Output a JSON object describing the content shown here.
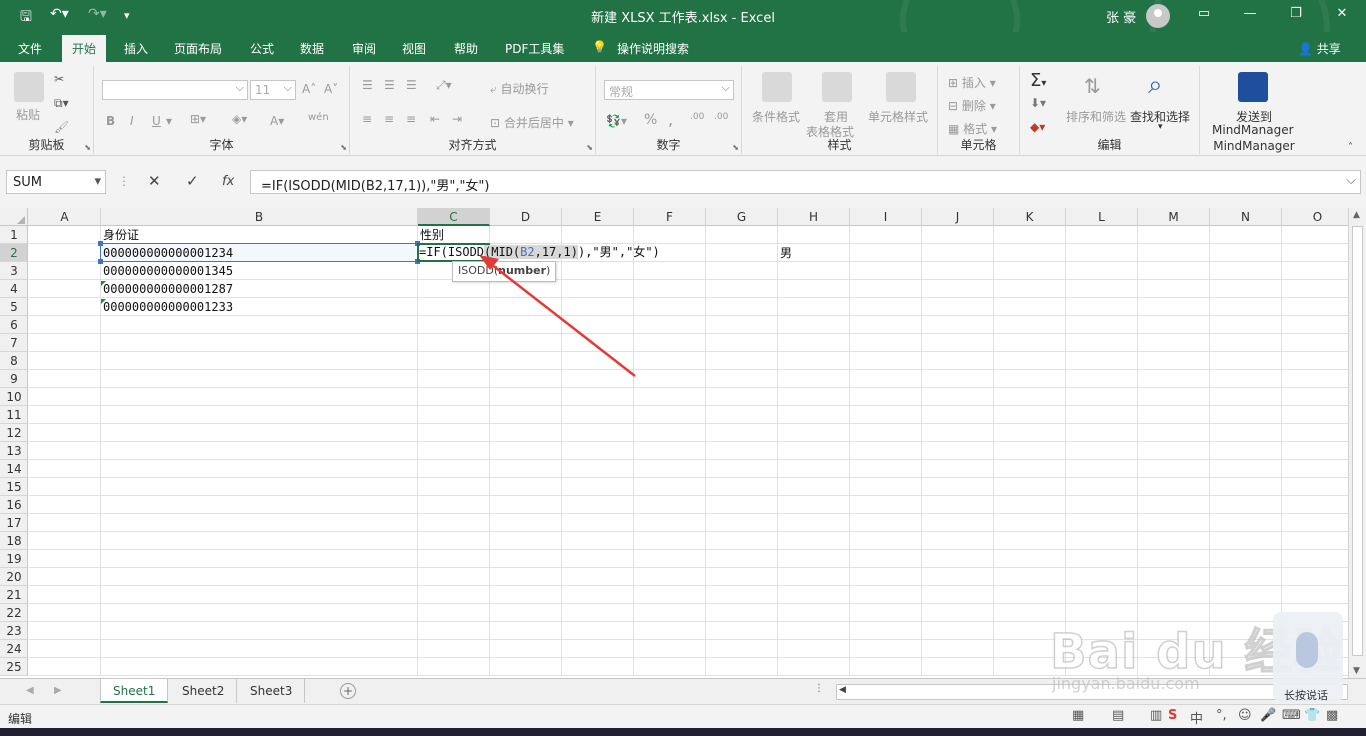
{
  "window": {
    "title": "新建 XLSX 工作表.xlsx  -  Excel",
    "user": "张 豪",
    "accent_color": "#217346",
    "controls": [
      "ribbon-display-icon",
      "minimize-icon",
      "restore-icon",
      "close-icon"
    ]
  },
  "quick_access": [
    "save-icon",
    "undo-icon",
    "redo-icon",
    "customize-icon"
  ],
  "ribbon_tabs": [
    "文件",
    "开始",
    "插入",
    "页面布局",
    "公式",
    "数据",
    "审阅",
    "视图",
    "帮助",
    "PDF工具集",
    "操作说明搜索"
  ],
  "active_tab": "开始",
  "share_label": "共享",
  "ribbon": {
    "clipboard": {
      "label": "剪贴板",
      "paste": "粘贴"
    },
    "font": {
      "label": "字体",
      "font_name": "",
      "font_size": "11",
      "bold": "B",
      "italic": "I",
      "underline": "U",
      "font_color": "A",
      "wen": "wén",
      "size_up": "A",
      "size_down": "A"
    },
    "alignment": {
      "label": "对齐方式",
      "wrap": "自动换行",
      "merge": "合并后居中"
    },
    "number": {
      "label": "数字",
      "format": "常规",
      "percent": "%",
      "comma": ",",
      "inc_dec": ".00",
      "dec_dec": ".00"
    },
    "styles": {
      "label": "样式",
      "conditional": "条件格式",
      "table_format_1": "套用",
      "table_format_2": "表格格式",
      "cell_styles": "单元格样式"
    },
    "cells": {
      "label": "单元格",
      "insert": "插入",
      "delete": "删除",
      "format": "格式"
    },
    "editing": {
      "label": "编辑",
      "sigma": "Σ",
      "sort": "排序和筛选",
      "find": "查找和选择"
    },
    "mindmanager": {
      "label": "MindManager",
      "send_1": "发送到",
      "send_2": "MindManager"
    }
  },
  "formula_bar": {
    "name_box": "SUM",
    "cancel": "✕",
    "enter": "✓",
    "fx": "fx",
    "formula": "=IF(ISODD(MID(B2,17,1)),\"男\",\"女\")"
  },
  "columns": [
    "A",
    "B",
    "C",
    "D",
    "E",
    "F",
    "G",
    "H",
    "I",
    "J",
    "K",
    "L",
    "M",
    "N",
    "O"
  ],
  "selected_column": "C",
  "rows": [
    "1",
    "2",
    "3",
    "4",
    "5",
    "6",
    "7",
    "8",
    "9",
    "10",
    "11",
    "12",
    "13",
    "14",
    "15",
    "16",
    "17",
    "18",
    "19",
    "20",
    "21",
    "22",
    "23",
    "24",
    "25",
    "26"
  ],
  "selected_row": "2",
  "cells": {
    "B1": "身份证",
    "B2": "000000000000001234",
    "B3": "000000000000001345",
    "B4": "000000000000001287",
    "B5": "000000000000001233",
    "C1": "性别",
    "H2": "男"
  },
  "edit_cell": {
    "p1": "=IF(ISODD",
    "p2": "(MID(",
    "p3": "B2",
    "p4": ",17,1)",
    "p5": ")",
    "p6": ",\"男\",\"女\")"
  },
  "tooltip": {
    "fn": "ISODD(",
    "arg": "number",
    "close": ")"
  },
  "sheets": [
    "Sheet1",
    "Sheet2",
    "Sheet3"
  ],
  "active_sheet": "Sheet1",
  "status": "编辑",
  "watermark": {
    "brand": "Bai du 经验",
    "url": "jingyan.baidu.com"
  },
  "voice_button": "长按说话"
}
